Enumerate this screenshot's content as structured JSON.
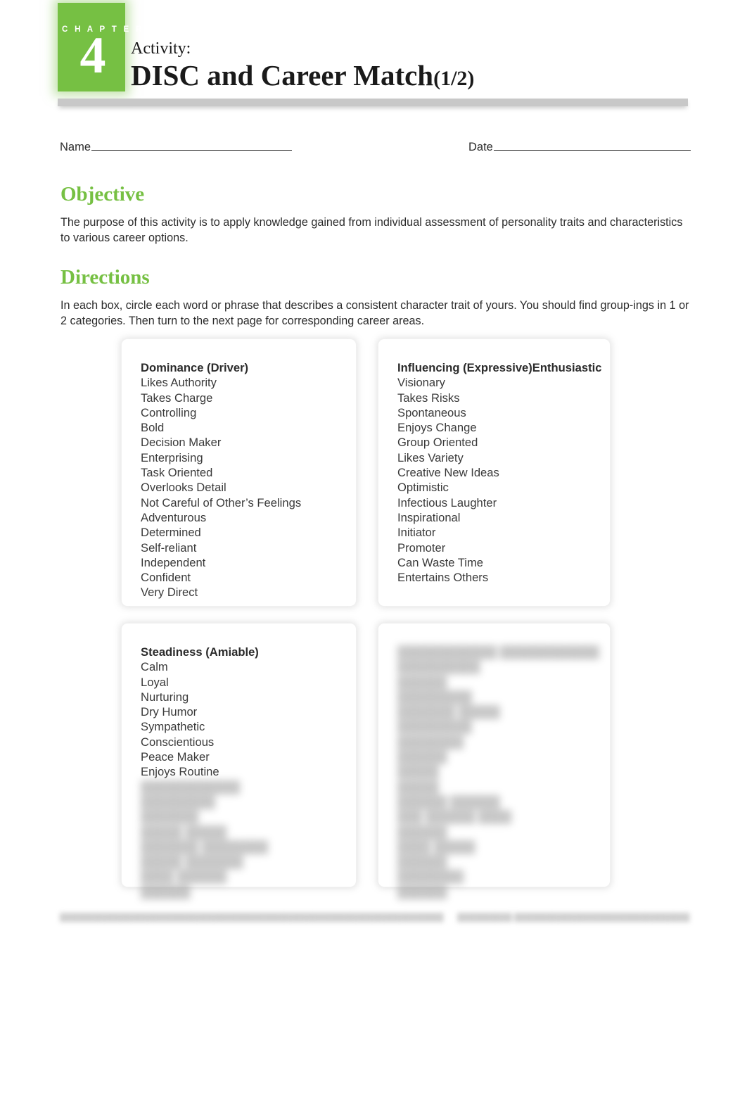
{
  "header": {
    "chapter_word": "C H A P T E R",
    "chapter_number": "4",
    "activity_label": "Activity:",
    "title": "DISC and Career Match",
    "page_fraction": "(1/2)",
    "accent_color": "#76c043",
    "rule_color": "#c8c8c8"
  },
  "fields": {
    "name_label": "Name",
    "name_value": "",
    "date_label": "Date",
    "date_value": ""
  },
  "sections": {
    "objective": {
      "heading": "Objective",
      "body": "The purpose of this activity is to apply knowledge gained from individual assessment of personality traits and characteristics to various career options."
    },
    "directions": {
      "heading": "Directions",
      "body": "In each box, circle each word or phrase that describes a consistent character trait of yours. You should find group-ings in 1 or 2 categories. Then turn to the next page for corresponding career areas."
    }
  },
  "boxes": [
    {
      "title": "Dominance (Driver)",
      "blurred": false,
      "traits": [
        "Likes Authority",
        "Takes Charge",
        "Controlling",
        "Bold",
        "Decision Maker",
        "Enterprising",
        "Task Oriented",
        "Overlooks Detail",
        "Not Careful of Other’s Feelings",
        "Adventurous",
        "Determined",
        "Self-reliant",
        "Independent",
        "Confident",
        "Very Direct"
      ]
    },
    {
      "title": "Influencing (Expressive)Enthusiastic",
      "blurred": false,
      "traits": [
        "Visionary",
        "Takes Risks",
        "Spontaneous",
        "Enjoys Change",
        "Group Oriented",
        "Likes Variety",
        "Creative New Ideas",
        "Optimistic",
        "Infectious Laughter",
        "Inspirational",
        "Initiator",
        "Promoter",
        "Can Waste Time",
        "Entertains Others"
      ]
    },
    {
      "title": "Steadiness (Amiable)",
      "blurred": false,
      "traits": [
        "Calm",
        "Loyal",
        "Nurturing",
        "Dry Humor",
        "Sympathetic",
        "Conscientious",
        "Peace Maker",
        "Enjoys Routine"
      ],
      "blurred_traits": [
        "████████████",
        "█████████",
        "███████",
        "█████ █████",
        "███████ ████████",
        "█████ ███████",
        "████ ██████",
        "██████"
      ]
    },
    {
      "title": "████████████ ████████████",
      "blurred": true,
      "traits": [
        "██████████",
        "██████",
        "█████████",
        "███████ █████",
        "█████████",
        "████████",
        "██████",
        "█████",
        "█████",
        "██████ ██████",
        "███ ██████ ████",
        "██████",
        "████ █████",
        "██████",
        "████████",
        "██████"
      ]
    }
  ],
  "footer": {
    "left": "██████████████████████████████████████████████████████████████████████",
    "right": "██████████ ████████████████████████████████"
  }
}
